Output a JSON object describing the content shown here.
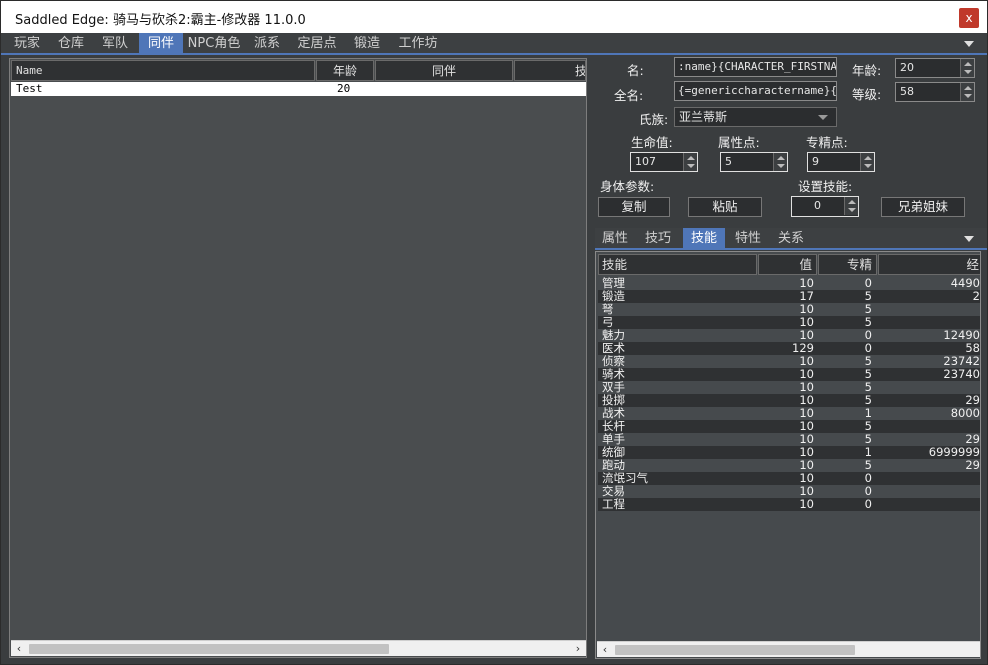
{
  "window": {
    "title": "Saddled Edge: 骑马与砍杀2:霸主-修改器 11.0.0",
    "close_label": "x"
  },
  "top_tabs": [
    "玩家",
    "仓库",
    "军队",
    "同伴",
    "NPC角色",
    "派系",
    "定居点",
    "锻造",
    "工作坊"
  ],
  "top_tabs_active": "同伴",
  "companion_list": {
    "columns": [
      "Name",
      "年龄",
      "同伴",
      "技"
    ],
    "rows": [
      {
        "name": "Test",
        "age": "20"
      }
    ]
  },
  "character": {
    "name_label": "名:",
    "name_value": ":name}{CHARACTER_FIRSTNAME}",
    "age_label": "年龄:",
    "age_value": "20",
    "fullname_label": "全名:",
    "fullname_value": "{=genericcharactername}{CHA",
    "level_label": "等级:",
    "level_value": "58",
    "culture_label": "氏族:",
    "culture_value": "亚兰蒂斯",
    "hp_label": "生命值:",
    "hp_value": "107",
    "attr_label": "属性点:",
    "attr_value": "5",
    "focus_label": "专精点:",
    "focus_value": "9",
    "body_label": "身体参数:",
    "set_skill_label": "设置技能:",
    "copy_label": "复制",
    "paste_label": "粘贴",
    "set_skill_value": "0",
    "siblings_label": "兄弟姐妹"
  },
  "sub_tabs": [
    "属性",
    "技巧",
    "技能",
    "特性",
    "关系"
  ],
  "sub_tabs_active": "技能",
  "skills": {
    "columns": [
      "技能",
      "值",
      "专精",
      "经"
    ],
    "rows": [
      {
        "name": "管理",
        "value": "10",
        "focus": "0",
        "exp": "4490"
      },
      {
        "name": "锻造",
        "value": "17",
        "focus": "5",
        "exp": "2"
      },
      {
        "name": "弩",
        "value": "10",
        "focus": "5",
        "exp": ""
      },
      {
        "name": "弓",
        "value": "10",
        "focus": "5",
        "exp": ""
      },
      {
        "name": "魅力",
        "value": "10",
        "focus": "0",
        "exp": "12490"
      },
      {
        "name": "医术",
        "value": "129",
        "focus": "0",
        "exp": "58"
      },
      {
        "name": "侦察",
        "value": "10",
        "focus": "5",
        "exp": "23742"
      },
      {
        "name": "骑术",
        "value": "10",
        "focus": "5",
        "exp": "23740"
      },
      {
        "name": "双手",
        "value": "10",
        "focus": "5",
        "exp": ""
      },
      {
        "name": "投掷",
        "value": "10",
        "focus": "5",
        "exp": "29"
      },
      {
        "name": "战术",
        "value": "10",
        "focus": "1",
        "exp": "8000"
      },
      {
        "name": "长杆",
        "value": "10",
        "focus": "5",
        "exp": ""
      },
      {
        "name": "单手",
        "value": "10",
        "focus": "5",
        "exp": "29"
      },
      {
        "name": "统御",
        "value": "10",
        "focus": "1",
        "exp": "6999999"
      },
      {
        "name": "跑动",
        "value": "10",
        "focus": "5",
        "exp": "29"
      },
      {
        "name": "流氓习气",
        "value": "10",
        "focus": "0",
        "exp": ""
      },
      {
        "name": "交易",
        "value": "10",
        "focus": "0",
        "exp": ""
      },
      {
        "name": "工程",
        "value": "10",
        "focus": "0",
        "exp": ""
      }
    ]
  },
  "colors": {
    "accent": "#4f76b8",
    "close": "#c0392b",
    "panel": "#464a4d"
  }
}
